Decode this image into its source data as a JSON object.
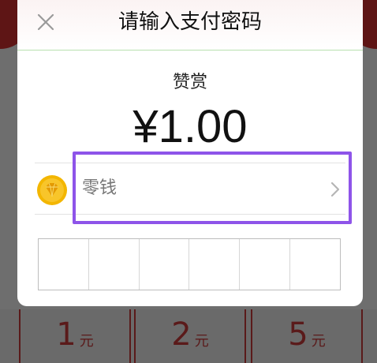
{
  "dialog": {
    "title": "请输入支付密码",
    "reward_label": "赞赏",
    "amount": "¥1.00",
    "payment_method": {
      "label": "零钱",
      "icon": "coin-diamond-icon"
    },
    "password_digits": 6
  },
  "background": {
    "amount_options": [
      {
        "number": "1",
        "unit": "元"
      },
      {
        "number": "2",
        "unit": "元"
      },
      {
        "number": "5",
        "unit": "元"
      }
    ]
  },
  "colors": {
    "highlight": "#8e54e9",
    "coin": "#f3b600",
    "background_accent": "#5a1a1a"
  }
}
